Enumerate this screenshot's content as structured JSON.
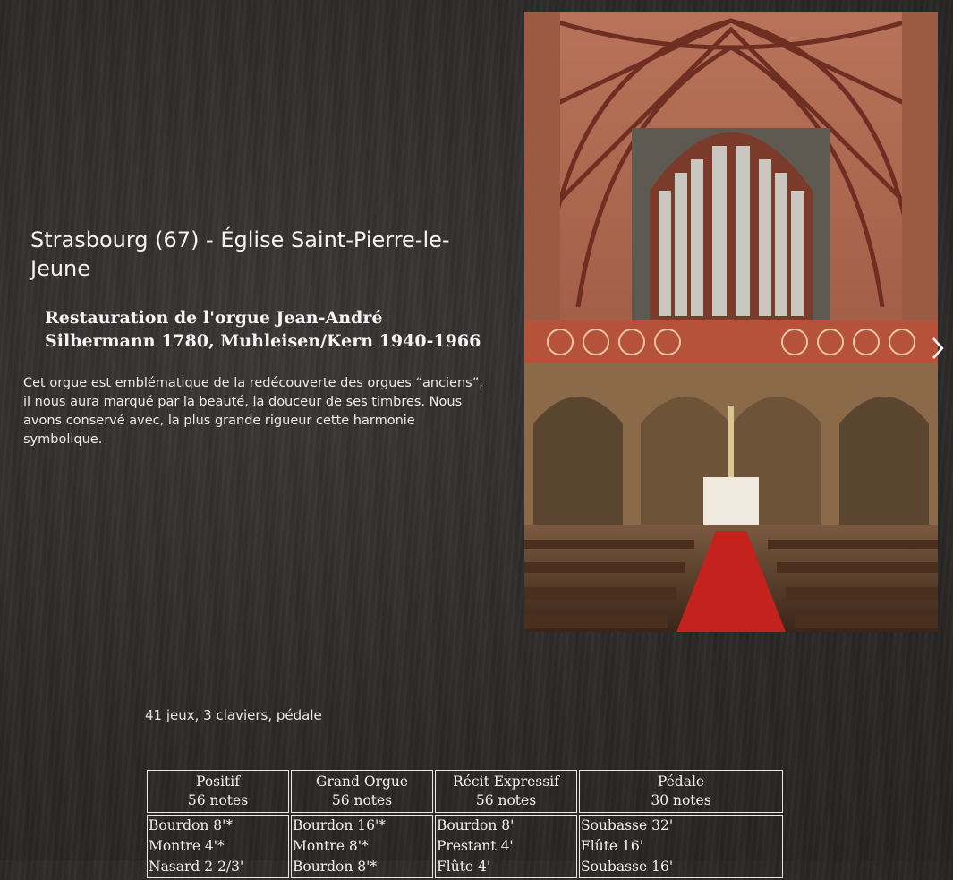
{
  "heading": {
    "title": "Strasbourg (67) - Église Saint-Pierre-le-Jeune",
    "subtitle": "Restauration de l'orgue Jean-André Silbermann 1780, Muhleisen/Kern 1940-1966",
    "description": "Cet orgue est emblématique de la redécouverte des orgues “anciens”, il nous aura marqué par la beauté, la douceur de ses timbres. Nous avons conservé avec, la plus grande rigueur cette harmonie symbolique."
  },
  "gallery": {
    "image_icon": "church-organ-photo",
    "next_icon": "chevron-right-icon"
  },
  "summary": "41 jeux, 3 claviers, pédale",
  "stops_table": {
    "columns": [
      {
        "name": "Positif",
        "notes": "56 notes",
        "stops": [
          "Bourdon 8'*",
          "Montre 4'*",
          "Nasard 2 2/3'"
        ]
      },
      {
        "name": "Grand Orgue",
        "notes": "56 notes",
        "stops": [
          "Bourdon 16'*",
          "Montre 8'*",
          "Bourdon 8'*"
        ]
      },
      {
        "name": "Récit Expressif",
        "notes": "56 notes",
        "stops": [
          "Bourdon 8'",
          "Prestant 4'",
          "Flûte 4'"
        ]
      },
      {
        "name": "Pédale",
        "notes": "30 notes",
        "stops": [
          "Soubasse 32'",
          "Flûte 16'",
          "Soubasse 16'"
        ]
      }
    ]
  },
  "colors": {
    "background": "#2e2c2b",
    "text": "#f0f0f0",
    "border": "#e8e8e8"
  }
}
